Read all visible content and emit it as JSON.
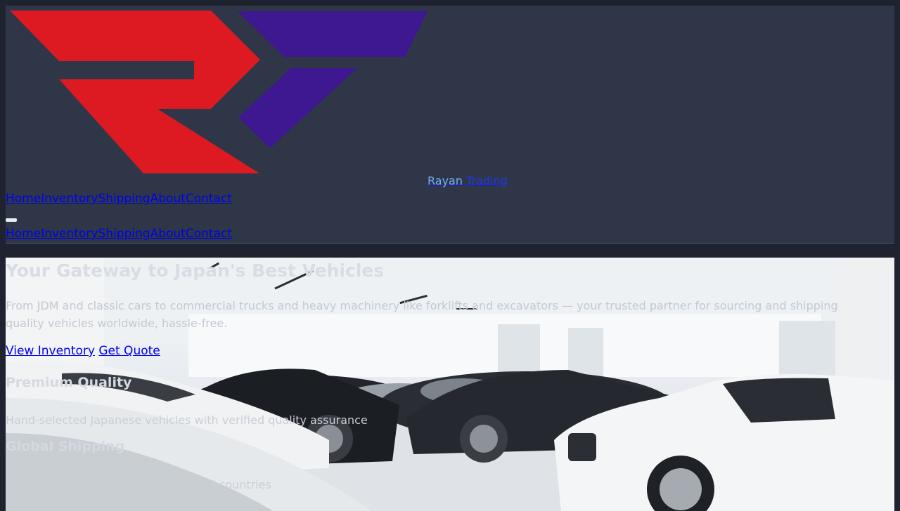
{
  "header": {
    "brand": {
      "part1": "Rayan",
      "part2": " Trading"
    },
    "nav_items": [
      "Home",
      "Inventory",
      "Shipping",
      "About",
      "Contact"
    ],
    "mobile_nav_items": [
      "Home",
      "Inventory",
      "Shipping",
      "About",
      "Contact"
    ]
  },
  "hero": {
    "title": "Your Gateway to Japan's Best Vehicles",
    "subtitle": "From JDM and classic cars to commercial trucks and heavy machinery like forklifts and excavators — your trusted partner for sourcing and shipping quality vehicles worldwide, hassle-free.",
    "cta_primary": "View Inventory",
    "cta_secondary": "Get Quote"
  },
  "features": [
    {
      "title": "Premium Quality",
      "description": "Hand-selected Japanese vehicles with verified quality assurance"
    },
    {
      "title": "Global Shipping",
      "description": "Secure worldwide delivery to over 15 countries"
    }
  ],
  "colors": {
    "header_bg": "#2e3648",
    "page_bg": "#1f2330",
    "logo_red": "#dd1a22",
    "logo_purple": "#3d1890",
    "link": "#0000ee"
  }
}
